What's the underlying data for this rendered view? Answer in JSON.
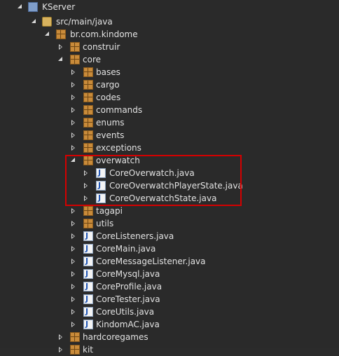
{
  "tree": {
    "project": "KServer",
    "source_folder": "src/main/java",
    "root_package": "br.com.kindome",
    "packages": {
      "construir": "construir",
      "core": "core",
      "bases": "bases",
      "cargo": "cargo",
      "codes": "codes",
      "commands": "commands",
      "enums": "enums",
      "events": "events",
      "exceptions": "exceptions",
      "overwatch": "overwatch",
      "tagapi": "tagapi",
      "utils": "utils",
      "hardcoregames": "hardcoregames",
      "partial_next": "kit"
    },
    "overwatch_files": [
      "CoreOverwatch.java",
      "CoreOverwatchPlayerState.java",
      "CoreOverwatchState.java"
    ],
    "core_files": [
      "CoreListeners.java",
      "CoreMain.java",
      "CoreMessageListener.java",
      "CoreMysql.java",
      "CoreProfile.java",
      "CoreTester.java",
      "CoreUtils.java",
      "KindomAC.java"
    ]
  },
  "colors": {
    "background": "#2a2a2a",
    "highlight_border": "#d40000",
    "java_j": "#2257b6",
    "package": "#c98b3a"
  }
}
